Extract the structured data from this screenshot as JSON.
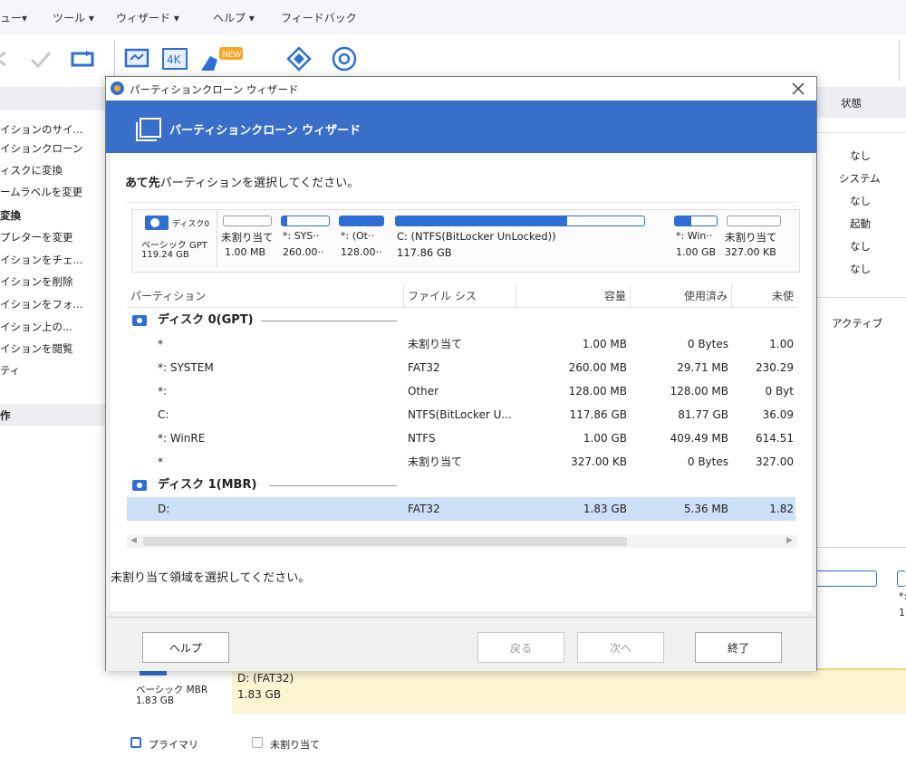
{
  "menubar": {
    "items": [
      "ュー▾",
      "ツール ▾",
      "ウィザード ▾",
      "ヘルプ ▾",
      "フィードバック"
    ]
  },
  "toolbar": {
    "new_badge": "NEW",
    "k4_label": "4K"
  },
  "left_panel": {
    "items": [
      "イションのサイ...",
      "イションクローン",
      "ィスクに変換",
      "ームラベルを変更",
      "変換",
      "プレターを変更",
      "イションをチェ...",
      "イションを削除",
      "イションをフォ...",
      "イション上の...",
      "イションを閲覧",
      "ティ"
    ],
    "section2": "作"
  },
  "right_panel": {
    "header": "状態",
    "statuses": [
      "なし",
      "システム",
      "なし",
      "起動",
      "なし",
      "なし"
    ],
    "active": "アクティブ"
  },
  "dialog": {
    "title": "パーティションクローン ウィザード",
    "header_title": "パーティションクローン ウィザード",
    "instruction_bold": "あて先",
    "instruction_rest": "パーティションを選択してください。",
    "disk0": {
      "label": "ディスク0",
      "type": "ベーシック GPT",
      "size": "119.24 GB",
      "partitions": [
        {
          "name": "未割り当て",
          "size": "1.00 MB",
          "fill": 0
        },
        {
          "name": "*: SYS··",
          "size": "260.00··",
          "fill": 0.11
        },
        {
          "name": "*: (Ot··",
          "size": "128.00··",
          "fill": 1
        },
        {
          "name": "C: (NTFS(BitLocker UnLocked))",
          "size": "117.86 GB",
          "fill": 0.69
        },
        {
          "name": "*: Win··",
          "size": "1.00 GB",
          "fill": 0.4
        },
        {
          "name": "未割り当て",
          "size": "327.00 KB",
          "fill": 0
        }
      ]
    },
    "table": {
      "columns": [
        "パーティション",
        "ファイル シス",
        "容量",
        "使用済み",
        "未使"
      ],
      "disk0_label": "ディスク 0(GPT)",
      "disk1_label": "ディスク 1(MBR)",
      "disk0_rows": [
        {
          "partition": "*",
          "fs": "未割り当て",
          "capacity": "1.00 MB",
          "used": "0 Bytes",
          "free": "1.00"
        },
        {
          "partition": "*: SYSTEM",
          "fs": "FAT32",
          "capacity": "260.00 MB",
          "used": "29.71 MB",
          "free": "230.29"
        },
        {
          "partition": "*:",
          "fs": "Other",
          "capacity": "128.00 MB",
          "used": "128.00 MB",
          "free": "0 Byt"
        },
        {
          "partition": "C:",
          "fs": "NTFS(BitLocker U...",
          "capacity": "117.86 GB",
          "used": "81.77 GB",
          "free": "36.09"
        },
        {
          "partition": "*: WinRE",
          "fs": "NTFS",
          "capacity": "1.00 GB",
          "used": "409.49 MB",
          "free": "614.51"
        },
        {
          "partition": "*",
          "fs": "未割り当て",
          "capacity": "327.00 KB",
          "used": "0 Bytes",
          "free": "327.00"
        }
      ],
      "disk1_rows": [
        {
          "partition": "D:",
          "fs": "FAT32",
          "capacity": "1.83 GB",
          "used": "5.36 MB",
          "free": "1.82"
        }
      ]
    },
    "hint": "未割り当て領域を選択してください。",
    "buttons": {
      "help": "ヘルプ",
      "back": "戻る",
      "next": "次へ",
      "finish": "終了"
    }
  },
  "bottom": {
    "disk1_type": "ベーシック MBR",
    "disk1_size": "1.83 GB",
    "partition_name": "D: (FAT32)",
    "partition_size": "1.83 GB",
    "right_label": "*:",
    "right_value": "1",
    "legend_primary": "プライマリ",
    "legend_unalloc": "未割り当て"
  },
  "colors": {
    "accent": "#3a6fc9",
    "bar": "#2f6fd3",
    "selected_row": "#cce0f7",
    "bottom_yellow": "#fdf5d2"
  }
}
